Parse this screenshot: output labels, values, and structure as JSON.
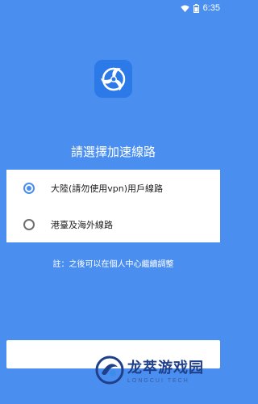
{
  "status_bar": {
    "time": "6:35",
    "icons": [
      "wifi-icon",
      "battery-icon"
    ]
  },
  "logo": {
    "icon": "fan-logo-icon"
  },
  "title": "請選擇加速線路",
  "options": [
    {
      "label": "大陸(請勿使用vpn)用戶線路",
      "checked": true
    },
    {
      "label": "港臺及海外線路",
      "checked": false
    }
  ],
  "note": "註：之後可以在個人中心繼續調整",
  "watermark": {
    "cn": "龙萃游戏园",
    "en": "LONGCUI TECH"
  },
  "colors": {
    "background": "#4a8ef0",
    "accent": "#4a8ef0",
    "card": "#ffffff"
  }
}
